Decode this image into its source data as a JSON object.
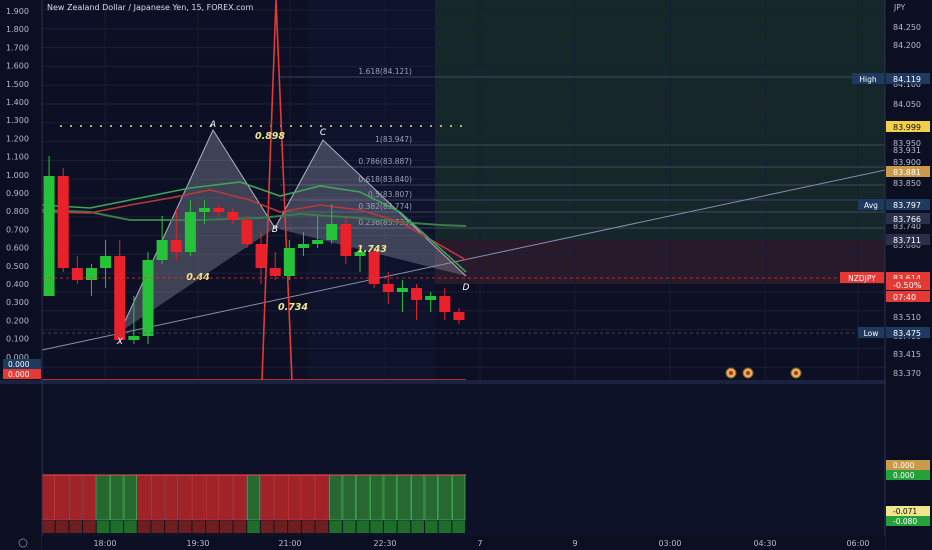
{
  "header": {
    "title": "New Zealand Dollar / Japanese Yen, 15, FOREX.com"
  },
  "chart_data": [
    {
      "type": "candlestick",
      "symbol": "NZDJPY",
      "currency": "JPY",
      "price_axis": {
        "unit": "JPY",
        "ticks": [
          "84.250",
          "84.200",
          "84.100",
          "84.050",
          "83.950",
          "83.931",
          "83.900",
          "83.850",
          "83.740",
          "83.680",
          "83.510",
          "83.460",
          "83.415",
          "83.370"
        ],
        "ylim": [
          83.35,
          84.3
        ]
      },
      "osc_axis": {
        "ticks": [
          "1.900",
          "1.800",
          "1.700",
          "1.600",
          "1.500",
          "1.400",
          "1.300",
          "1.200",
          "1.100",
          "1.000",
          "0.900",
          "0.800",
          "0.700",
          "0.600",
          "0.500",
          "0.400",
          "0.300",
          "0.200",
          "0.100",
          "0.000"
        ]
      },
      "price_tags": [
        {
          "label": "High",
          "value": "84.119",
          "bg": "#1e3a5f"
        },
        {
          "label": "",
          "value": "83.999",
          "bg": "#f0d04a"
        },
        {
          "label": "",
          "value": "83.881",
          "bg": "#c89a4a"
        },
        {
          "label": "Avg",
          "value": "83.797",
          "bg": "#1e3a5f"
        },
        {
          "label": "",
          "value": "83.766",
          "bg": "#2a2f4a"
        },
        {
          "label": "",
          "value": "83.711",
          "bg": "#2a2f4a"
        },
        {
          "label": "NZDJPY",
          "value": "83.614",
          "bg": "#e53935"
        },
        {
          "label": "",
          "value": "-0.50%",
          "bg": "#e53935"
        },
        {
          "label": "",
          "value": "07:40",
          "bg": "#e53935"
        },
        {
          "label": "Low",
          "value": "83.475",
          "bg": "#1e3a5f"
        }
      ],
      "osc_tags": [
        "0.000",
        "0.000"
      ],
      "fib_labels": [
        "1.618(84.121)",
        "1(83.947)",
        "0.786(83.887)",
        "0.618(83.840)",
        "0.5(83.807)",
        "0.382(83.774)",
        "0.236(83.733)"
      ],
      "harmonic_points": [
        "X",
        "A",
        "B",
        "C",
        "D"
      ],
      "harmonic_ratios": [
        "0.898",
        "0.44",
        "0.734",
        "1.743"
      ],
      "candles": [
        {
          "o": 83.56,
          "h": 83.91,
          "l": 83.56,
          "c": 83.86
        },
        {
          "o": 83.86,
          "h": 83.88,
          "l": 83.62,
          "c": 83.63
        },
        {
          "o": 83.63,
          "h": 83.66,
          "l": 83.59,
          "c": 83.6
        },
        {
          "o": 83.6,
          "h": 83.64,
          "l": 83.56,
          "c": 83.63
        },
        {
          "o": 83.63,
          "h": 83.7,
          "l": 83.58,
          "c": 83.66
        },
        {
          "o": 83.66,
          "h": 83.7,
          "l": 83.44,
          "c": 83.45
        },
        {
          "o": 83.45,
          "h": 83.56,
          "l": 83.44,
          "c": 83.46
        },
        {
          "o": 83.46,
          "h": 83.67,
          "l": 83.44,
          "c": 83.65
        },
        {
          "o": 83.65,
          "h": 83.76,
          "l": 83.64,
          "c": 83.7
        },
        {
          "o": 83.7,
          "h": 83.78,
          "l": 83.65,
          "c": 83.67
        },
        {
          "o": 83.67,
          "h": 83.8,
          "l": 83.66,
          "c": 83.77
        },
        {
          "o": 83.77,
          "h": 83.8,
          "l": 83.74,
          "c": 83.78
        },
        {
          "o": 83.78,
          "h": 83.79,
          "l": 83.76,
          "c": 83.77
        },
        {
          "o": 83.77,
          "h": 83.78,
          "l": 83.74,
          "c": 83.75
        },
        {
          "o": 83.75,
          "h": 83.76,
          "l": 83.68,
          "c": 83.69
        },
        {
          "o": 83.69,
          "h": 83.72,
          "l": 83.59,
          "c": 83.63
        },
        {
          "o": 83.63,
          "h": 83.67,
          "l": 83.6,
          "c": 83.61
        },
        {
          "o": 83.61,
          "h": 83.7,
          "l": 83.6,
          "c": 83.68
        },
        {
          "o": 83.68,
          "h": 83.72,
          "l": 83.66,
          "c": 83.69
        },
        {
          "o": 83.69,
          "h": 83.76,
          "l": 83.68,
          "c": 83.7
        },
        {
          "o": 83.7,
          "h": 83.79,
          "l": 83.69,
          "c": 83.74
        },
        {
          "o": 83.74,
          "h": 83.76,
          "l": 83.64,
          "c": 83.66
        },
        {
          "o": 83.66,
          "h": 83.68,
          "l": 83.62,
          "c": 83.67
        },
        {
          "o": 83.67,
          "h": 83.68,
          "l": 83.58,
          "c": 83.59
        },
        {
          "o": 83.59,
          "h": 83.62,
          "l": 83.54,
          "c": 83.57
        },
        {
          "o": 83.57,
          "h": 83.6,
          "l": 83.52,
          "c": 83.58
        },
        {
          "o": 83.58,
          "h": 83.59,
          "l": 83.5,
          "c": 83.55
        },
        {
          "o": 83.55,
          "h": 83.57,
          "l": 83.52,
          "c": 83.56
        },
        {
          "o": 83.56,
          "h": 83.58,
          "l": 83.5,
          "c": 83.52
        },
        {
          "o": 83.52,
          "h": 83.53,
          "l": 83.49,
          "c": 83.5
        }
      ],
      "time_axis": [
        "18:00",
        "19:30",
        "21:00",
        "22:30",
        "7",
        "9",
        "03:00",
        "04:30",
        "06:00"
      ]
    },
    {
      "type": "histogram",
      "title": "",
      "ticks": [
        "0.000",
        "0.000",
        "-0.071",
        "-0.080"
      ],
      "bar_colors": [
        "#c62828",
        "#2e7d32"
      ],
      "bars": [
        -1,
        -1,
        -1,
        -1,
        1,
        1,
        1,
        -1,
        -1,
        -1,
        -1,
        -1,
        -1,
        -1,
        -1,
        1,
        -1,
        -1,
        -1,
        -1,
        -1,
        1,
        1,
        1,
        1,
        1,
        1,
        1,
        1,
        1,
        1
      ]
    }
  ]
}
